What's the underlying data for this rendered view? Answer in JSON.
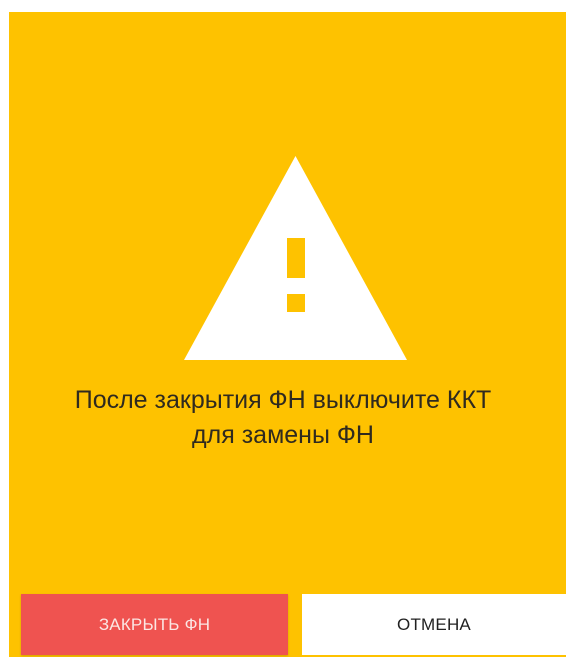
{
  "dialog": {
    "icon": "warning-triangle-icon",
    "message": "После закрытия ФН выключите ККТ\nдля замены ФН",
    "background_color": "#FEC200"
  },
  "buttons": {
    "confirm_label": "ЗАКРЫТЬ ФН",
    "confirm_color": "#EF5350",
    "cancel_label": "ОТМЕНА"
  }
}
